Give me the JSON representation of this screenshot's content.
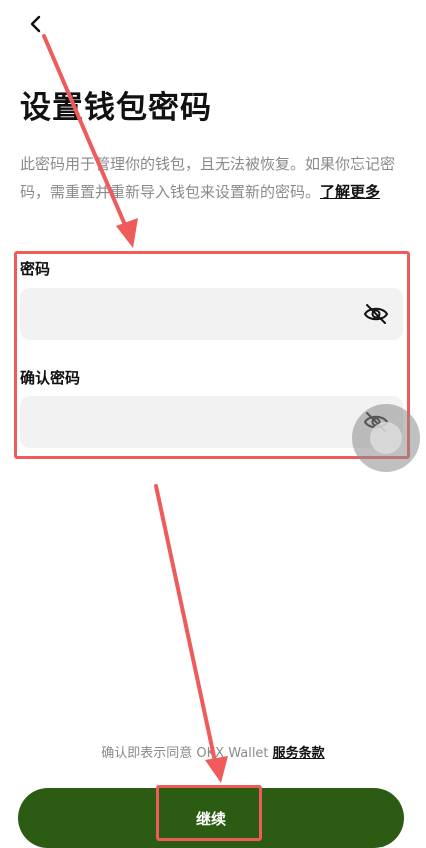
{
  "header": {
    "back_icon": "chevron-left-icon"
  },
  "page": {
    "title": "设置钱包密码",
    "description": "此密码用于管理你的钱包，且无法被恢复。如果你忘记密码，需重置并重新导入钱包来设置新的密码。",
    "learn_more": "了解更多"
  },
  "form": {
    "password_label": "密码",
    "password_value": "",
    "confirm_label": "确认密码",
    "confirm_value": "",
    "visibility_icon": "eye-off-icon"
  },
  "footer": {
    "terms_prefix": "确认即表示同意 OKX Wallet ",
    "terms_link": "服务条款",
    "continue_label": "继续"
  },
  "colors": {
    "primary_button": "#2c5c13",
    "annotation_red": "#ef5b5b",
    "input_bg": "#f2f2f2"
  }
}
